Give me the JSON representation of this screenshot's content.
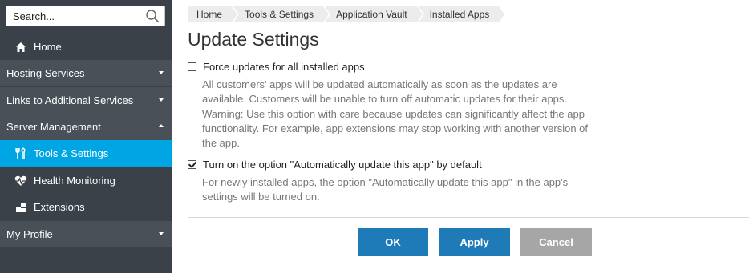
{
  "sidebar": {
    "search_placeholder": "Search...",
    "items": [
      {
        "label": "Home",
        "icon": "home-icon"
      },
      {
        "label": "Hosting Services"
      },
      {
        "label": "Links to Additional Services"
      },
      {
        "label": "Server Management"
      },
      {
        "label": "Tools & Settings",
        "icon": "tools-icon",
        "active": true
      },
      {
        "label": "Health Monitoring",
        "icon": "heart-pulse-icon"
      },
      {
        "label": "Extensions",
        "icon": "extensions-icon"
      },
      {
        "label": "My Profile"
      }
    ],
    "active_color": "#00a6e3",
    "bg_color": "#3b4148"
  },
  "breadcrumb": [
    "Home",
    "Tools & Settings",
    "Application Vault",
    "Installed Apps"
  ],
  "page_title": "Update Settings",
  "options": [
    {
      "label": "Force updates for all installed apps",
      "checked": false,
      "description": "All customers' apps will be updated automatically as soon as the updates are available. Customers will be unable to turn off automatic updates for their apps. Warning: Use this option with care because updates can significantly affect the app functionality. For example, app extensions may stop working with another version of the app."
    },
    {
      "label": "Turn on the option \"Automatically update this app\" by default",
      "checked": true,
      "description": "For newly installed apps, the option \"Automatically update this app\" in the app's settings will be turned on."
    }
  ],
  "buttons": {
    "ok": "OK",
    "apply": "Apply",
    "cancel": "Cancel"
  },
  "colors": {
    "primary_button": "#1f7ab8",
    "cancel_button": "#a6a6a6"
  }
}
